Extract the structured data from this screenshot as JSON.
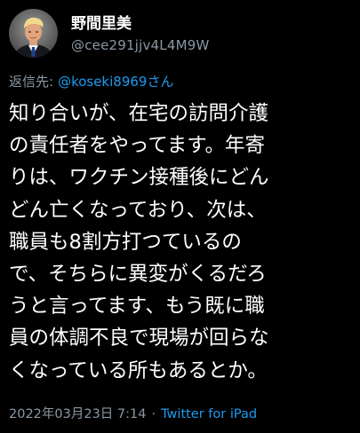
{
  "tweet": {
    "author": {
      "display_name": "野間里美",
      "handle": "@cee291jjv4L4M9W",
      "avatar_icon": "profile-photo-icon"
    },
    "reply": {
      "prefix": "返信先:",
      "target": "@koseki8969さん"
    },
    "body_lines": [
      "知り合いが、在宅の訪問介護",
      "の責任者をやってます。年寄",
      "りは、ワクチン接種後にどん",
      "どん亡くなっており、次は、",
      "職員も8割方打つているの",
      "で、そちらに異変がくるだろ",
      "うと言ってます、もう既に職",
      "員の体調不良で現場が回らな",
      "くなっている所もあるとか。"
    ],
    "meta": {
      "timestamp": "2022年03月23日 7:14",
      "separator": "·",
      "source": "Twitter for iPad"
    }
  },
  "colors": {
    "background": "#000000",
    "text_primary": "#ffffff",
    "text_secondary": "#8b98a5",
    "link": "#1d9bf0"
  }
}
